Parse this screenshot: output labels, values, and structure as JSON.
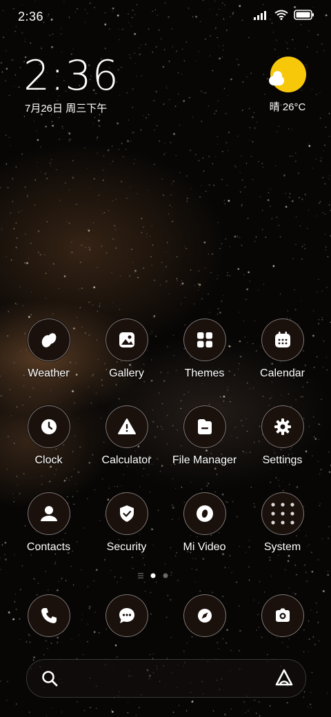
{
  "status_bar": {
    "time": "2:36",
    "icons": [
      "signal-icon",
      "wifi-icon",
      "battery-icon"
    ]
  },
  "lock_clock": {
    "time": "2:36",
    "date": "7月26日 周三下午"
  },
  "weather_widget": {
    "condition_temp": "晴 26°C",
    "icon": "sun-cloud-icon",
    "color": "#f7c80a"
  },
  "apps": [
    {
      "label": "Weather",
      "icon": "weather-icon"
    },
    {
      "label": "Gallery",
      "icon": "gallery-icon"
    },
    {
      "label": "Themes",
      "icon": "themes-icon"
    },
    {
      "label": "Calendar",
      "icon": "calendar-icon"
    },
    {
      "label": "Clock",
      "icon": "clock-icon"
    },
    {
      "label": "Calculator",
      "icon": "calculator-icon"
    },
    {
      "label": "File Manager",
      "icon": "file-manager-icon"
    },
    {
      "label": "Settings",
      "icon": "settings-icon"
    },
    {
      "label": "Contacts",
      "icon": "contacts-icon"
    },
    {
      "label": "Security",
      "icon": "security-icon"
    },
    {
      "label": "Mi Video",
      "icon": "mi-video-icon"
    },
    {
      "label": "System",
      "icon": "system-folder-icon"
    }
  ],
  "page_indicator": {
    "pages": 2,
    "current": 1
  },
  "dock": [
    "phone-icon",
    "messages-icon",
    "browser-icon",
    "camera-icon"
  ],
  "search_bar": {
    "icons": [
      "search-icon",
      "assistant-icon"
    ]
  }
}
